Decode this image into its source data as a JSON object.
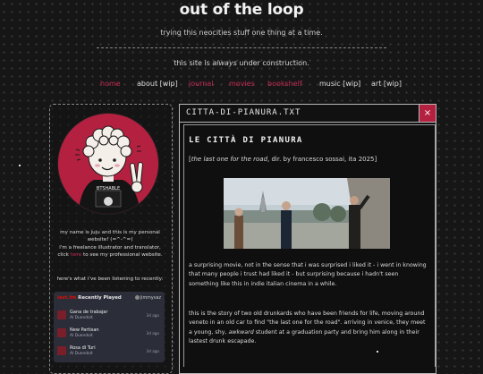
{
  "header": {
    "title": "out of the loop",
    "subtitle": "trying this neocities stuff one thing at a time.",
    "construction_prefix": "this site is ",
    "construction_emphasis": "always",
    "construction_suffix": " under construction."
  },
  "nav": {
    "items": [
      {
        "label": "home",
        "active": true
      },
      {
        "label": "about [wip]",
        "active": false
      },
      {
        "label": "journal",
        "active": true
      },
      {
        "label": "movies",
        "active": true
      },
      {
        "label": "bookshelf",
        "active": true
      },
      {
        "label": "music [wip]",
        "active": false
      },
      {
        "label": "art [wip]",
        "active": false
      }
    ]
  },
  "sidebar": {
    "avatar_shirt_text": "BTSHABLE",
    "bio_line1": "my name is juju and this is my personal",
    "bio_line2": "website! (=^-^=)",
    "bio_line3": "i'm a freelance illustrator and translator,",
    "bio_click": "click ",
    "bio_here": "here",
    "bio_after": " to see my professional website.",
    "listening": "here's what i've been listening to recently:",
    "lastfm": {
      "brand": "last.fm",
      "heading": "Recently Played",
      "username": "jimmyvaz",
      "tracks": [
        {
          "title": "Gana de trabajar",
          "artist": "Al Duendoit",
          "time": "3d ago"
        },
        {
          "title": "New Partisan",
          "artist": "Al Duendoit",
          "time": "3d ago"
        },
        {
          "title": "Rosa di Turi",
          "artist": "Al Duendoit",
          "time": "3d ago"
        }
      ]
    }
  },
  "window": {
    "title": "CITTA-DI-PIANURA.TXT",
    "close": "×"
  },
  "post": {
    "heading": "LE CITTÀ DI PIANURA",
    "meta_open": "[",
    "meta_film": "the last one for the road",
    "meta_rest": ", dir. by francesco sossai, ita 2025]",
    "para1": "a surprising movie, not in the sense that i was surprised i liked it - i went in knowing that many people i trust had liked it - but surprising because i hadn't seen something like this in indie italian cinema in a while.",
    "para2_a": "this is the story of two old drunkards who have been friends for life, moving around veneto in an old car to find \"the last one for the road\". arriving in venice, they meet a young, shy, ",
    "para2_em": "awkward",
    "para2_b": " student at a graduation party and bring him along in their lastest drunk escapade."
  }
}
